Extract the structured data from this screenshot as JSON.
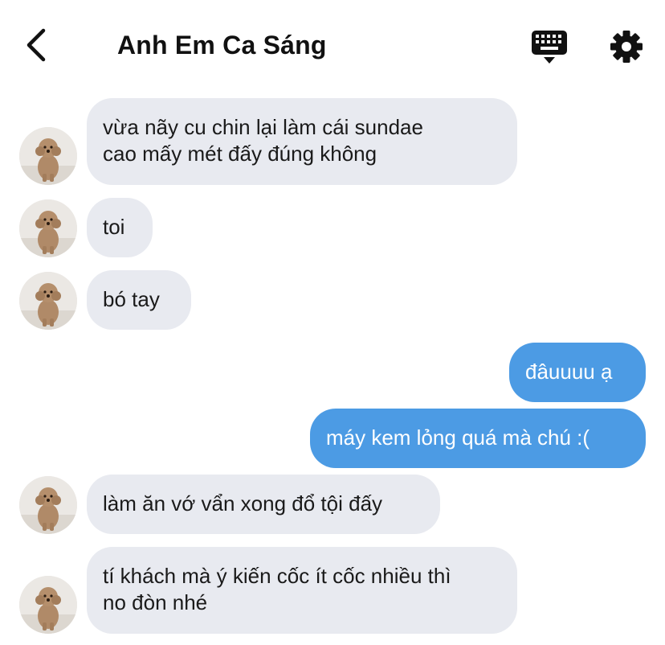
{
  "header": {
    "title": "Anh Em Ca Sáng",
    "back_icon": "chevron-left-icon",
    "keyboard_icon": "keyboard-icon",
    "settings_icon": "gear-icon"
  },
  "colors": {
    "incoming_bubble": "#e8eaf0",
    "outgoing_bubble": "#4c9be4",
    "text": "#111111"
  },
  "messages": [
    {
      "direction": "incoming",
      "text": "vừa nãy cu chin lại làm cái sundae\ncao mấy mét đấy đúng không"
    },
    {
      "direction": "incoming",
      "text": "toi"
    },
    {
      "direction": "incoming",
      "text": "bó tay"
    },
    {
      "direction": "outgoing",
      "text": "đâuuuu ạ"
    },
    {
      "direction": "outgoing",
      "text": "máy kem lỏng quá mà chú :("
    },
    {
      "direction": "incoming",
      "text": "làm ăn vớ vẩn xong đổ tội đấy"
    },
    {
      "direction": "incoming",
      "text": "tí khách mà ý kiến cốc ít cốc nhiều thì\nno đòn nhé"
    }
  ]
}
